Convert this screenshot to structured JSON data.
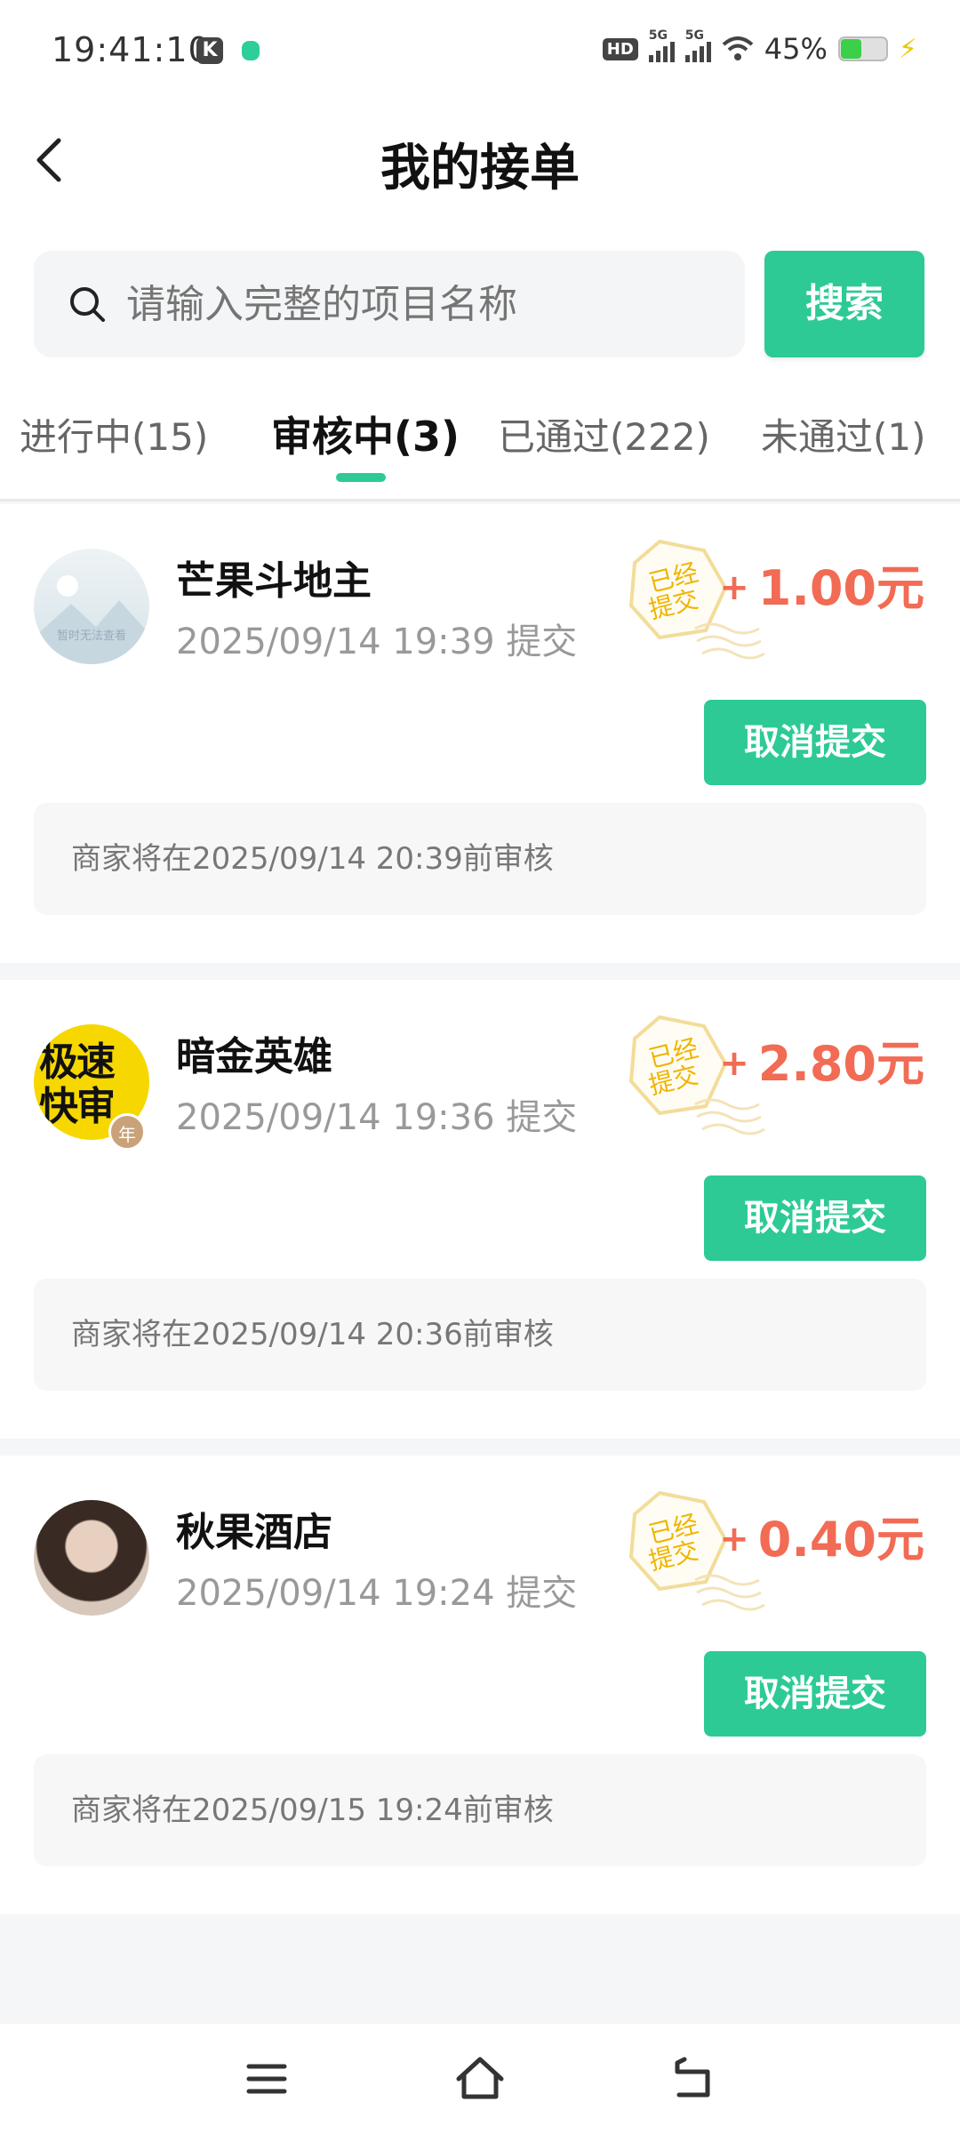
{
  "status_bar": {
    "time": "19:41:10",
    "app_badge": "K",
    "hd_label": "HD",
    "network_1": "5G",
    "network_2": "5G",
    "battery_percent": "45%",
    "battery_level": 0.45
  },
  "header": {
    "title": "我的接单",
    "back_icon": "chevron-left-icon"
  },
  "search": {
    "placeholder": "请输入完整的项目名称",
    "button_label": "搜索"
  },
  "tabs": [
    {
      "label": "进行中(15)",
      "active": false
    },
    {
      "label": "审核中(3)",
      "active": true
    },
    {
      "label": "已通过(222)",
      "active": false
    },
    {
      "label": "未通过(1)",
      "active": false
    }
  ],
  "orders": [
    {
      "name": "芒果斗地主",
      "submitted": "2025/09/14 19:39 提交",
      "stamp": "已经提交",
      "amount": "1.00元",
      "plus": "+",
      "cancel_label": "取消提交",
      "review_note": "商家将在2025/09/14 20:39前审核",
      "avatar_text": "暂时无法查看"
    },
    {
      "name": "暗金英雄",
      "submitted": "2025/09/14 19:36 提交",
      "stamp": "已经提交",
      "amount": "2.80元",
      "plus": "+",
      "cancel_label": "取消提交",
      "review_note": "商家将在2025/09/14 20:36前审核",
      "avatar_text": "极速快审",
      "avatar_badge": "年"
    },
    {
      "name": "秋果酒店",
      "submitted": "2025/09/14 19:24 提交",
      "stamp": "已经提交",
      "amount": "0.40元",
      "plus": "+",
      "cancel_label": "取消提交",
      "review_note": "商家将在2025/09/15 19:24前审核"
    }
  ],
  "colors": {
    "accent": "#2dca95",
    "amount": "#f26b54",
    "stamp": "#f0b400"
  },
  "nav": {
    "menu_icon": "menu-icon",
    "home_icon": "home-icon",
    "back_icon": "back-icon"
  }
}
